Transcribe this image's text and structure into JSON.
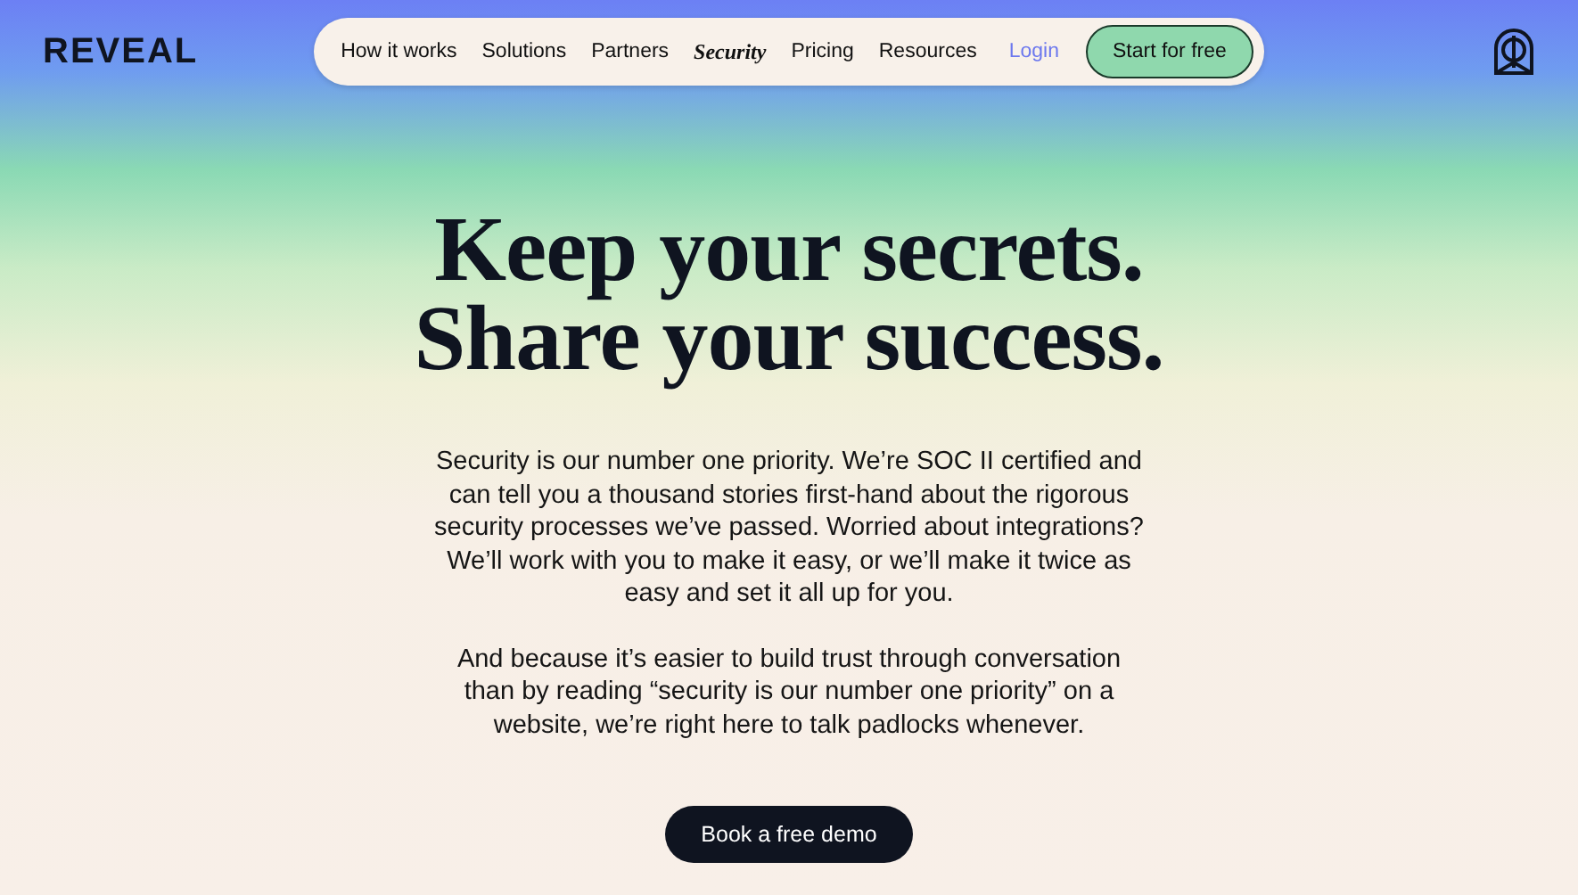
{
  "brand": {
    "name": "REVEAL"
  },
  "nav": {
    "items": [
      {
        "label": "How it works",
        "kind": "item",
        "selected": false
      },
      {
        "label": "Solutions",
        "kind": "item",
        "selected": false
      },
      {
        "label": "Partners",
        "kind": "item",
        "selected": false
      },
      {
        "label": "Security",
        "kind": "item",
        "selected": true
      },
      {
        "label": "Pricing",
        "kind": "item",
        "selected": false
      },
      {
        "label": "Resources",
        "kind": "item",
        "selected": false
      },
      {
        "label": "Login",
        "kind": "link"
      },
      {
        "label": "Start for free",
        "kind": "cta"
      }
    ]
  },
  "hero": {
    "headline": [
      "Keep your secrets.",
      "Share your success."
    ],
    "paragraphs": [
      "Security is our number one priority. We’re SOC II certified and can tell you a thousand stories first-hand about the rigorous security processes we’ve passed. Worried about integrations? We’ll work with you to make it easy, or we’ll make it twice as easy and set it all up for you.",
      "And because it’s easier to build trust through conversation than by reading “security is our number one priority” on a website, we’re right here to talk padlocks whenever."
    ],
    "button": "Book a free demo"
  }
}
